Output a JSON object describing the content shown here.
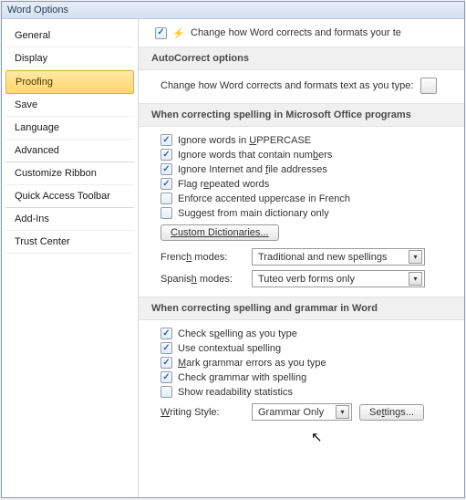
{
  "title": "Word Options",
  "sidebar": {
    "items": [
      {
        "label": "General"
      },
      {
        "label": "Display"
      },
      {
        "label": "Proofing",
        "selected": true
      },
      {
        "label": "Save"
      },
      {
        "label": "Language"
      },
      {
        "label": "Advanced"
      },
      {
        "label": "Customize Ribbon"
      },
      {
        "label": "Quick Access Toolbar"
      },
      {
        "label": "Add-Ins"
      },
      {
        "label": "Trust Center"
      }
    ]
  },
  "top": {
    "checked": true,
    "text": "Change how Word corrects and formats your te"
  },
  "groups": {
    "autocorrect": {
      "header": "AutoCorrect options",
      "line": "Change how Word corrects and formats text as you type:"
    },
    "office": {
      "header": "When correcting spelling in Microsoft Office programs",
      "options": [
        {
          "checked": true,
          "pre": "Ignore words in ",
          "u": "U",
          "post": "PPERCASE"
        },
        {
          "checked": true,
          "pre": "Ignore words that contain num",
          "u": "b",
          "post": "ers"
        },
        {
          "checked": true,
          "pre": "Ignore Internet and ",
          "u": "f",
          "post": "ile addresses"
        },
        {
          "checked": true,
          "pre": "Flag r",
          "u": "e",
          "post": "peated words"
        },
        {
          "checked": false,
          "pre": "Enforce accented uppercase in French",
          "u": "",
          "post": ""
        },
        {
          "checked": false,
          "pre": "Suggest from main dictionary only",
          "u": "",
          "post": ""
        }
      ],
      "custom_btn": "Custom Dictionaries...",
      "french_label": "French modes:",
      "french_value": "Traditional and new spellings",
      "spanish_label": "Spanish modes:",
      "spanish_value": "Tuteo verb forms only"
    },
    "word": {
      "header": "When correcting spelling and grammar in Word",
      "options": [
        {
          "checked": true,
          "pre": "Check s",
          "u": "p",
          "post": "elling as you type"
        },
        {
          "checked": true,
          "pre": "Use contextual spelling",
          "u": "",
          "post": ""
        },
        {
          "checked": true,
          "pre": "",
          "u": "M",
          "post": "ark grammar errors as you type"
        },
        {
          "checked": true,
          "pre": "Check grammar with spelling",
          "u": "",
          "post": ""
        },
        {
          "checked": false,
          "pre": "Show readability statistics",
          "u": "",
          "post": ""
        }
      ],
      "writing_label": "Writing Style:",
      "writing_value": "Grammar Only",
      "settings_btn": "Settings..."
    }
  }
}
